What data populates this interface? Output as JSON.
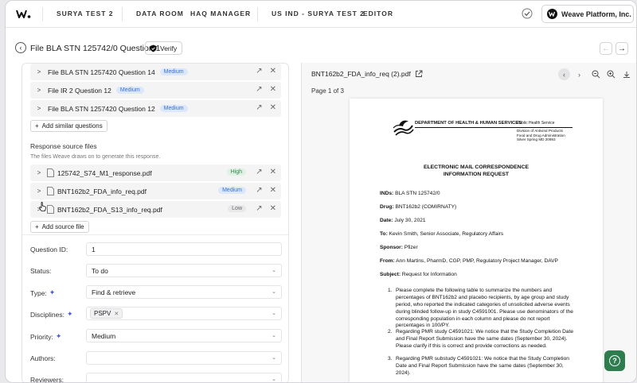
{
  "nav": {
    "items": [
      "SURYA TEST 2",
      "DATA ROOM",
      "HAQ MANAGER",
      "US IND - SURYA TEST 2",
      "EDITOR"
    ],
    "org_name": "Weave Platform, Inc."
  },
  "header": {
    "title": "File BLA STN 125742/0 Question 1",
    "verify_label": "Verify"
  },
  "similar_questions": [
    {
      "label": "File BLA STN 1257420 Question 14",
      "tag": "Medium"
    },
    {
      "label": "File IR 2 Question 12",
      "tag": "Medium"
    },
    {
      "label": "File BLA STN 1257420 Question 12",
      "tag": "Medium"
    }
  ],
  "add_similar_label": "Add similar questions",
  "response_sources": {
    "heading": "Response source files",
    "subtext": "The files Weave draws on to generate this response.",
    "files": [
      {
        "name": "125742_S74_M1_response.pdf",
        "tag": "High"
      },
      {
        "name": "BNT162b2_FDA_info_req.pdf",
        "tag": "Medium"
      },
      {
        "name": "BNT162b2_FDA_S13_info_req.pdf",
        "tag": "Low"
      }
    ],
    "add_label": "Add source file"
  },
  "fields": {
    "question_id": {
      "label": "Question ID:",
      "value": "1"
    },
    "status": {
      "label": "Status:",
      "value": "To do"
    },
    "type": {
      "label": "Type:",
      "value": "Find & retrieve"
    },
    "disciplines": {
      "label": "Disciplines:",
      "value": "PSPV"
    },
    "priority": {
      "label": "Priority:",
      "value": "Medium"
    },
    "authors": {
      "label": "Authors:",
      "value": ""
    },
    "reviewers": {
      "label": "Reviewers:",
      "value": ""
    }
  },
  "viewer": {
    "file_name": "BNT162b2_FDA_info_req (2).pdf",
    "page_info": "Page 1 of 3"
  },
  "document": {
    "agency": "DEPARTMENT OF HEALTH & HUMAN SERVICES",
    "service": "Public Health Service",
    "division": [
      "Division of Antiviral Products",
      "Food and Drug Administration",
      "Silver Spring MD 20993"
    ],
    "title_line1": "ELECTRONIC MAIL CORRESPONDENCE",
    "title_line2": "INFORMATION REQUEST",
    "meta": [
      {
        "k": "INDs:",
        "v": "BLA STN 125742/0"
      },
      {
        "k": "Drug:",
        "v": "BNT162b2 (COMIRNATY)"
      },
      {
        "k": "Date:",
        "v": "July 30, 2021"
      },
      {
        "k": "To:",
        "v": "Kevin Smith, Senior Associate, Regulatory Affairs"
      },
      {
        "k": "Sponsor:",
        "v": "Pfizer"
      },
      {
        "k": "From:",
        "v": "Ann Martins, PharmD, CGP, PMP, Regulatory Project Manager, DAVP"
      },
      {
        "k": "Subject:",
        "v": "Request for Information"
      }
    ],
    "items": [
      "Please complete the following table to summarize the numbers and percentages of BNT162b2 and placebo recipients, by age group and study period, who reported the indicated categories of unsolicited adverse events during blinded follow-up in study C4591001. Please use denominators of the corresponding population in each column and please do not report percentages in 100/PY.",
      "Regarding PMR study C4591021: We notice that the Study Completion Date and Final Report Submission have the same dates (September 30, 2024). Please clarify if this is correct and provide corrections as needed.",
      "Regarding PMR substudy C4591021: We notice that the Study Completion Date and Final Report Submission have the same dates (September 30, 2024)."
    ]
  }
}
